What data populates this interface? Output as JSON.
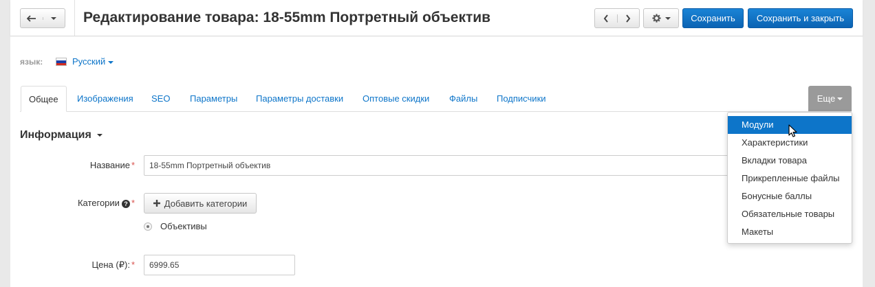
{
  "header": {
    "title": "Редактирование товара: 18-55mm Портретный объектив",
    "save_label": "Сохранить",
    "save_close_label": "Сохранить и закрыть"
  },
  "language": {
    "label": "язык:",
    "selected": "Русский",
    "flag_colors": [
      "#ffffff",
      "#1c3fa8",
      "#d52b1e"
    ]
  },
  "tabs": [
    {
      "label": "Общее",
      "active": true
    },
    {
      "label": "Изображения"
    },
    {
      "label": "SEO"
    },
    {
      "label": "Параметры"
    },
    {
      "label": "Параметры доставки"
    },
    {
      "label": "Оптовые скидки"
    },
    {
      "label": "Файлы"
    },
    {
      "label": "Подписчики"
    }
  ],
  "more_tab": {
    "label": "Еще"
  },
  "more_menu": {
    "items": [
      {
        "label": "Модули",
        "active": true
      },
      {
        "label": "Характеристики"
      },
      {
        "label": "Вкладки товара"
      },
      {
        "label": "Прикрепленные файлы"
      },
      {
        "label": "Бонусные баллы"
      },
      {
        "label": "Обязательные товары"
      },
      {
        "label": "Макеты"
      }
    ]
  },
  "section": {
    "title": "Информация"
  },
  "form": {
    "name_label": "Название",
    "name_value": "18-55mm Портретный объектив",
    "categories_label": "Категории",
    "add_categories_label": "Добавить категории",
    "category_option": "Объективы",
    "price_label": "Цена (₽):",
    "price_value": "6999.65",
    "required_mark": "*",
    "help_mark": "?"
  },
  "icons": {
    "back": "back-arrow-icon",
    "prev": "chevron-left-icon",
    "next": "chevron-right-icon",
    "settings": "gear-icon",
    "add": "plus-icon"
  },
  "colors": {
    "accent": "#0d75c9",
    "primary_button": "#1173c7",
    "more_tab": "#9a9a9a",
    "required": "#d9534f"
  }
}
